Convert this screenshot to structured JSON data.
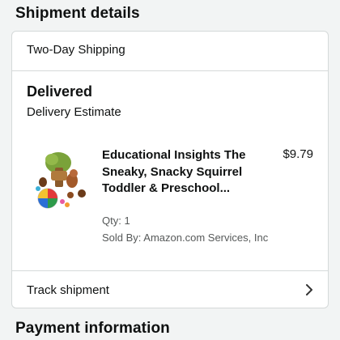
{
  "shipment": {
    "section_title": "Shipment details",
    "shipping_method": "Two-Day Shipping",
    "status": "Delivered",
    "estimate_label": "Delivery Estimate",
    "item": {
      "title": "Educational Insights The Sneaky, Snacky Squirrel Toddler & Preschool...",
      "price": "$9.79",
      "qty": "Qty: 1",
      "sold_by": "Sold By: Amazon.com Services, Inc",
      "image_icon": "product-thumbnail"
    },
    "track_label": "Track shipment",
    "track_icon": "chevron-right-icon"
  },
  "payment": {
    "section_title": "Payment information"
  },
  "colors": {
    "background": "#f2f4f4",
    "card": "#ffffff",
    "border": "#d5d9d9",
    "text": "#0f1111",
    "secondary_text": "#565959"
  }
}
